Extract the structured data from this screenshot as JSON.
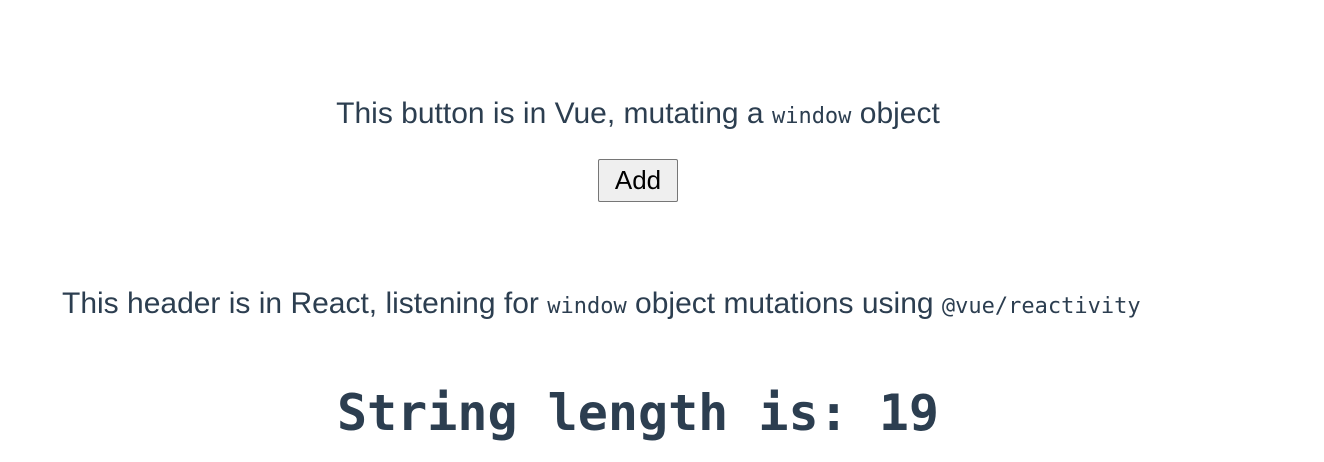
{
  "vue_section": {
    "text_before": "This button is in Vue, mutating a ",
    "code": "window",
    "text_after": " object",
    "button_label": "Add"
  },
  "react_section": {
    "text_before": "This header is in React, listening for ",
    "code_object": "window",
    "text_middle": " object mutations using ",
    "code_library": "@vue/reactivity",
    "length_label": "String length is: ",
    "length_value": "19"
  }
}
